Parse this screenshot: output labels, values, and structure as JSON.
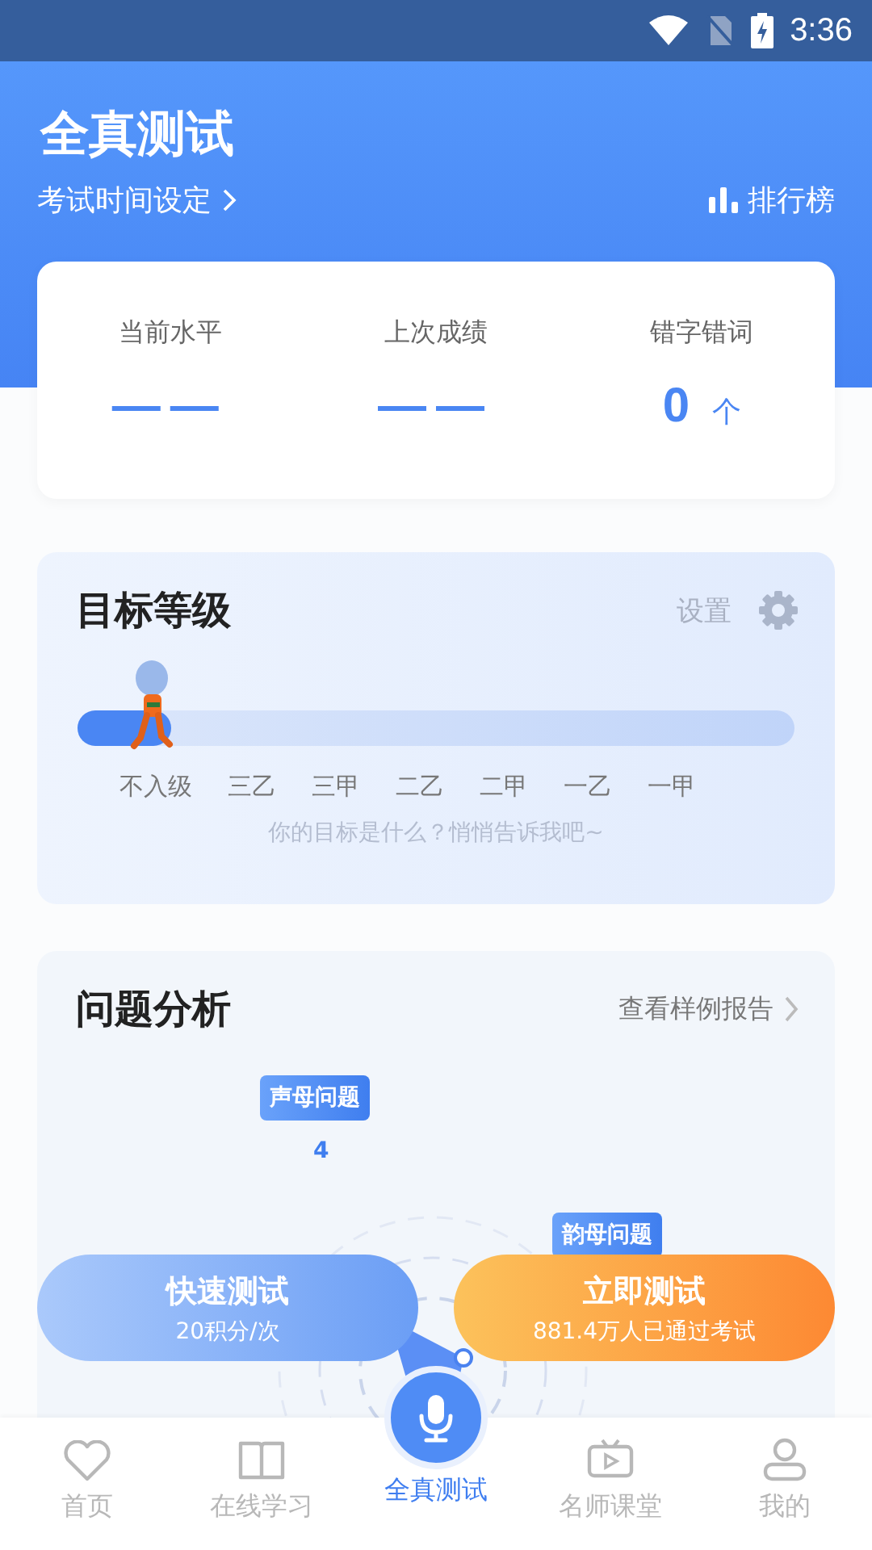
{
  "status_bar": {
    "time": "3:36"
  },
  "header": {
    "title": "全真测试",
    "exam_time_link": "考试时间设定",
    "ranking_link": "排行榜"
  },
  "stats": [
    {
      "label": "当前水平",
      "value": "——"
    },
    {
      "label": "上次成绩",
      "value": "——"
    },
    {
      "label": "错字错词",
      "value": "0",
      "unit": "个"
    }
  ],
  "target": {
    "title": "目标等级",
    "settings_label": "设置",
    "level": 0.13,
    "levels": [
      "不入级",
      "三乙",
      "三甲",
      "二乙",
      "二甲",
      "一乙",
      "一甲"
    ],
    "hint": "你的目标是什么？悄悄告诉我吧~"
  },
  "analysis": {
    "title": "问题分析",
    "report_link": "查看样例报告",
    "axis_value": "4",
    "tags": [
      "声母问题",
      "韵母问题"
    ]
  },
  "actions": [
    {
      "kind": "quick",
      "title": "快速测试",
      "subtitle": "20积分/次"
    },
    {
      "kind": "start",
      "title": "立即测试",
      "subtitle": "881.4万人已通过考试"
    }
  ],
  "nav": [
    {
      "label": "首页",
      "selected": false
    },
    {
      "label": "在线学习",
      "selected": false
    },
    {
      "label": "全真测试",
      "selected": true
    },
    {
      "label": "名师课堂",
      "selected": false
    },
    {
      "label": "我的",
      "selected": false
    }
  ]
}
